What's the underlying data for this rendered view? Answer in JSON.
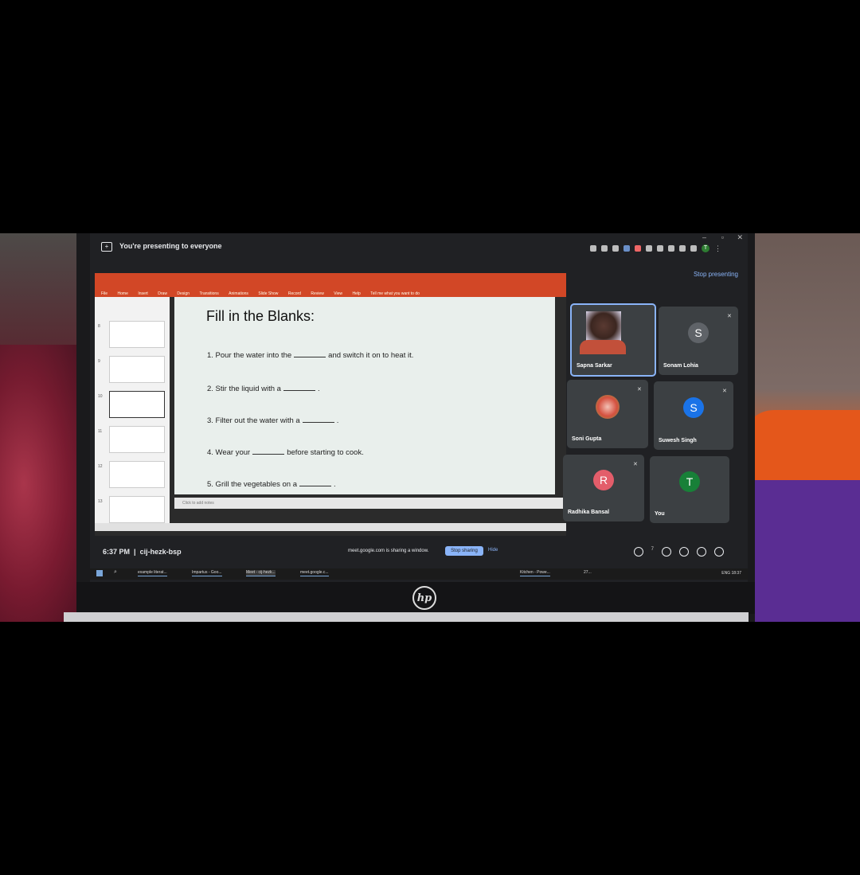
{
  "meet": {
    "presenting_banner": "You're presenting to everyone",
    "stop_presenting": "Stop presenting",
    "time": "6:37 PM",
    "separator": "|",
    "meeting_code": "cij-hezk-bsp",
    "sharing_text": "meet.google.com is sharing a window.",
    "stop_sharing": "Stop sharing",
    "hide": "Hide",
    "participants_count": "7",
    "profile_initial": "T",
    "participants": [
      {
        "name": "Sapna Sarkar",
        "initial": "",
        "color": ""
      },
      {
        "name": "Sonam Lohia",
        "initial": "S",
        "color": "#5f6368"
      },
      {
        "name": "Soni Gupta",
        "initial": "",
        "color": ""
      },
      {
        "name": "Suwesh Singh",
        "initial": "S",
        "color": "#1a73e8"
      },
      {
        "name": "Radhika Bansal",
        "initial": "R",
        "color": "#e35d6a"
      },
      {
        "name": "You",
        "initial": "T",
        "color": "#188038"
      }
    ]
  },
  "slide": {
    "title": "Fill in the Blanks:",
    "questions": [
      {
        "pre": "1. Pour the water into the",
        "post": "and switch it on to heat it."
      },
      {
        "pre": "2. Stir the liquid with a",
        "post": "."
      },
      {
        "pre": "3. Filter out the water with a",
        "post": "."
      },
      {
        "pre": "4. Wear your",
        "post": "before starting to cook."
      },
      {
        "pre": "5. Grill the vegetables on a",
        "post": "."
      }
    ],
    "notes_placeholder": "Click to add notes"
  },
  "ppt": {
    "ribbon_tabs": [
      "File",
      "Home",
      "Insert",
      "Draw",
      "Design",
      "Transitions",
      "Animations",
      "Slide Show",
      "Record",
      "Review",
      "View",
      "Help"
    ],
    "search": "Tell me what you want to do",
    "slide_numbers": [
      "8",
      "9",
      "10",
      "11",
      "12",
      "13"
    ]
  },
  "taskbar": {
    "items": [
      "example literat...",
      "Impartus - Goo...",
      "Meet - cij-hezk...",
      "meet.google.c...",
      "Kitchen - Powe..."
    ],
    "tray": "ENG  18:37",
    "weather": "27..."
  },
  "brand": {
    "logo": "hp"
  }
}
